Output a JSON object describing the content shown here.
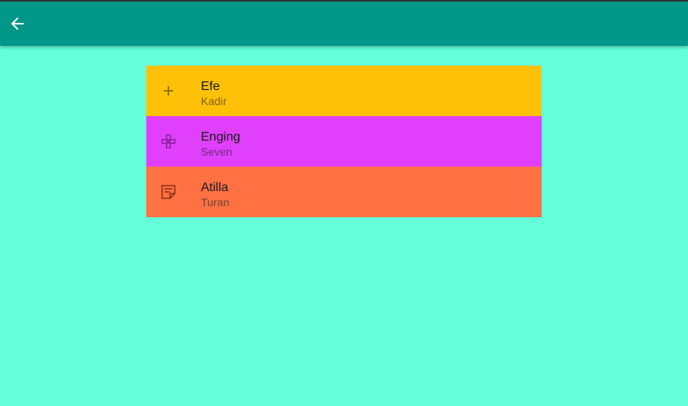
{
  "app_bar": {
    "back_icon": "arrow-back-icon",
    "color": "#009688"
  },
  "list": [
    {
      "title": "Efe",
      "subtitle": "Kadir",
      "icon": "add-icon",
      "color": "#ffc107"
    },
    {
      "title": "Enging",
      "subtitle": "Seven",
      "icon": "gamepad-icon",
      "color": "#e040fb"
    },
    {
      "title": "Atilla",
      "subtitle": "Turan",
      "icon": "note-icon",
      "color": "#ff7043"
    }
  ],
  "background": "#64ffda"
}
